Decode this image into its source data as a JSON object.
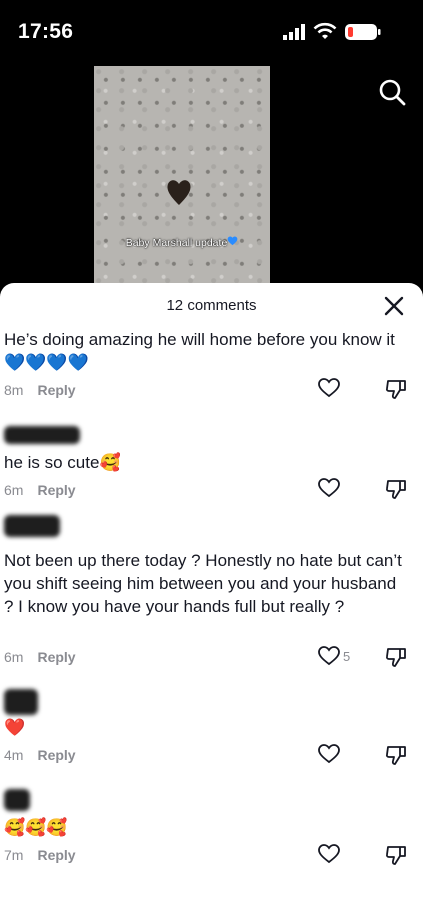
{
  "status_bar": {
    "time": "17:56",
    "icons": [
      "cellular-signal-icon",
      "wifi-icon",
      "battery-low-icon"
    ]
  },
  "video": {
    "caption": "Baby Marshall update",
    "caption_emoji": "blue-heart"
  },
  "header": {
    "search_icon": "search-icon"
  },
  "comments_sheet": {
    "title": "12 comments",
    "close_icon": "close-icon",
    "comments": [
      {
        "text": "He’s doing amazing he will home before you know it 💙💙💙💙",
        "time": "8m",
        "reply": "Reply",
        "likes": ""
      },
      {
        "text": "he is so cute🥰",
        "time": "6m",
        "reply": "Reply",
        "likes": ""
      },
      {
        "text": "Not been up there today ? Honestly no hate but can’t you shift seeing him between you and your husband ? I know you have your hands full but really ?",
        "time": "6m",
        "reply": "Reply",
        "likes": "5"
      },
      {
        "text": "❤️",
        "time": "4m",
        "reply": "Reply",
        "likes": ""
      },
      {
        "text": "🥰🥰🥰",
        "time": "7m",
        "reply": "Reply",
        "likes": ""
      }
    ]
  },
  "colors": {
    "background_top": "#000000",
    "text": "#161823",
    "muted": "#8a8b91",
    "heart_emoji": "#1d7bff"
  }
}
